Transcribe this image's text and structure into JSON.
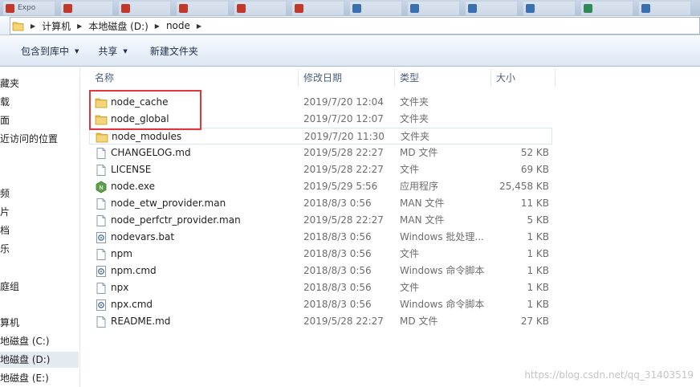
{
  "taskbar": {
    "items": [
      {
        "label": "Expo",
        "color": "#c0392b"
      },
      {
        "label": "",
        "color": "#c0392b"
      },
      {
        "label": "",
        "color": "#c0392b"
      },
      {
        "label": "",
        "color": "#c0392b"
      },
      {
        "label": "",
        "color": "#c0392b"
      },
      {
        "label": "",
        "color": "#c0392b"
      },
      {
        "label": "",
        "color": "#3a6fb0"
      },
      {
        "label": "",
        "color": "#3a6fb0"
      },
      {
        "label": "",
        "color": "#3a6fb0"
      },
      {
        "label": "",
        "color": "#3a6fb0"
      },
      {
        "label": "",
        "color": "#2e8b57"
      },
      {
        "label": "",
        "color": "#3a6fb0"
      }
    ]
  },
  "address": {
    "crumbs": [
      "计算机",
      "本地磁盘 (D:)",
      "node"
    ]
  },
  "toolbar": {
    "include_label": "包含到库中",
    "share_label": "共享",
    "new_folder_label": "新建文件夹"
  },
  "nav": {
    "items": [
      {
        "label": "收藏夹",
        "selected": false
      },
      {
        "label": "下载",
        "selected": false
      },
      {
        "label": "桌面",
        "selected": false
      },
      {
        "label": "最近访问的位置",
        "selected": false
      },
      {
        "label": "视频",
        "selected": false
      },
      {
        "label": "图片",
        "selected": false
      },
      {
        "label": "文档",
        "selected": false
      },
      {
        "label": "音乐",
        "selected": false
      },
      {
        "label": "家庭组",
        "selected": false
      },
      {
        "label": "计算机",
        "selected": false
      },
      {
        "label": "本地磁盘 (C:)",
        "selected": false
      },
      {
        "label": "本地磁盘 (D:)",
        "selected": true
      },
      {
        "label": "本地磁盘 (E:)",
        "selected": false
      }
    ]
  },
  "columns": {
    "name": "名称",
    "date": "修改日期",
    "type": "类型",
    "size": "大小"
  },
  "files": [
    {
      "name": "node_cache",
      "date": "2019/7/20 12:04",
      "type": "文件夹",
      "size": "",
      "icon": "folder-icon"
    },
    {
      "name": "node_global",
      "date": "2019/7/20 12:07",
      "type": "文件夹",
      "size": "",
      "icon": "folder-icon"
    },
    {
      "name": "node_modules",
      "date": "2019/7/20 11:30",
      "type": "文件夹",
      "size": "",
      "icon": "folder-icon"
    },
    {
      "name": "CHANGELOG.md",
      "date": "2019/5/28 22:27",
      "type": "MD 文件",
      "size": "52 KB",
      "icon": "document-icon"
    },
    {
      "name": "LICENSE",
      "date": "2019/5/28 22:27",
      "type": "文件",
      "size": "69 KB",
      "icon": "document-icon"
    },
    {
      "name": "node.exe",
      "date": "2019/5/29 5:56",
      "type": "应用程序",
      "size": "25,458 KB",
      "icon": "nodejs-icon"
    },
    {
      "name": "node_etw_provider.man",
      "date": "2018/8/3 0:56",
      "type": "MAN 文件",
      "size": "11 KB",
      "icon": "document-icon"
    },
    {
      "name": "node_perfctr_provider.man",
      "date": "2019/5/28 22:27",
      "type": "MAN 文件",
      "size": "5 KB",
      "icon": "document-icon"
    },
    {
      "name": "nodevars.bat",
      "date": "2018/8/3 0:56",
      "type": "Windows 批处理...",
      "size": "1 KB",
      "icon": "batch-file-icon"
    },
    {
      "name": "npm",
      "date": "2018/8/3 0:56",
      "type": "文件",
      "size": "1 KB",
      "icon": "document-icon"
    },
    {
      "name": "npm.cmd",
      "date": "2018/8/3 0:56",
      "type": "Windows 命令脚本",
      "size": "1 KB",
      "icon": "batch-file-icon"
    },
    {
      "name": "npx",
      "date": "2018/8/3 0:56",
      "type": "文件",
      "size": "1 KB",
      "icon": "document-icon"
    },
    {
      "name": "npx.cmd",
      "date": "2018/8/3 0:56",
      "type": "Windows 命令脚本",
      "size": "1 KB",
      "icon": "batch-file-icon"
    },
    {
      "name": "README.md",
      "date": "2019/5/28 22:27",
      "type": "MD 文件",
      "size": "27 KB",
      "icon": "document-icon"
    }
  ],
  "watermark": "https://blog.csdn.net/qq_31403519",
  "colors": {
    "highlight_box": "#e0383a",
    "folder": "#f2c14e"
  }
}
